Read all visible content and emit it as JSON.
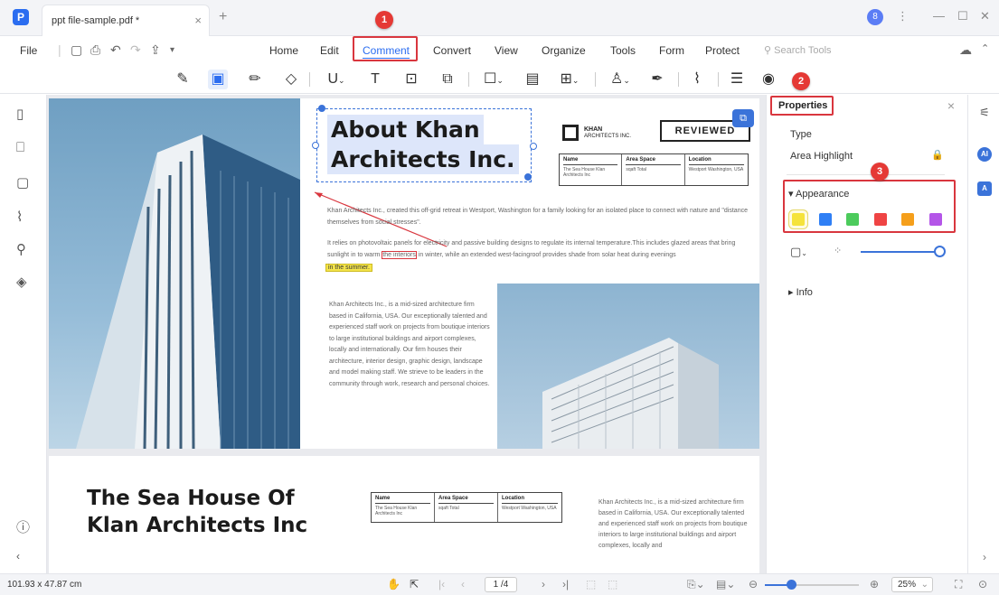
{
  "window": {
    "tab_title": "ppt file-sample.pdf *",
    "tab_close": "×",
    "new_tab": "+",
    "avatar_letter": "8",
    "more": "⋮",
    "minimize": "—",
    "maximize": "☐",
    "close": "✕"
  },
  "menu": {
    "file": "File",
    "items": [
      "Home",
      "Edit",
      "Comment",
      "Convert",
      "View",
      "Organize",
      "Tools",
      "Form",
      "Protect"
    ],
    "active": "Comment",
    "search_placeholder": "Search Tools"
  },
  "callouts": {
    "one": "1",
    "two": "2",
    "three": "3"
  },
  "document": {
    "page1": {
      "title_line1": "About Khan",
      "title_line2": "Architects Inc.",
      "logo_name": "KHAN",
      "logo_sub": "ARCHITECTS INC.",
      "stamp": "REVIEWED",
      "table": {
        "headers": [
          "Name",
          "Area Space",
          "Location"
        ],
        "values": [
          "The Sea House Klan Architects Inc",
          "sqaft Total",
          "Westport Washington, USA"
        ]
      },
      "para1": "Khan Architects Inc., created this off-grid retreat in Westport, Washington for a family looking for an isolated place to connect with nature and \"distance themselves from social stresses\".",
      "para2_a": "It relies on photovoltaic panels for electricity and passive building designs to regulate its internal temperature.This includes glazed areas that bring sunlight in to warm",
      "para2_box": "the interiors",
      "para2_b": "in winter, while an extended west-facingroof provides shade from solar heat during evenings",
      "para2_highlight": "in the summer.",
      "para3": "Khan Architects Inc., is a mid-sized architecture firm based in California, USA. Our exceptionally talented and experienced staff work on projects from boutique interiors to large institutional buildings and airport complexes, locally and internationally. Our firm houses their architecture, interior design, graphic design, landscape and model making staff. We strieve to be leaders in the community through work, research and personal choices."
    },
    "page2": {
      "title_line1": "The Sea House Of",
      "title_line2": "Klan Architects Inc",
      "table": {
        "headers": [
          "Name",
          "Area Space",
          "Location"
        ],
        "values": [
          "The Sea House Klan Architects Inc",
          "sqaft Total",
          "Westport Washington, USA"
        ]
      },
      "para": "Khan Architects Inc., is a mid-sized architecture firm based in California, USA. Our exceptionally talented and experienced staff work on projects from boutique interiors to large institutional buildings and airport complexes, locally and"
    }
  },
  "properties": {
    "title": "Properties",
    "close": "×",
    "type_label": "Type",
    "type_value": "Area Highlight",
    "appearance": "Appearance",
    "info": "Info",
    "swatches": [
      "#f5e33b",
      "#2f7ff5",
      "#4ccb5c",
      "#ef4444",
      "#f59f1b",
      "#b455e8"
    ]
  },
  "status": {
    "dimensions": "101.93 x 47.87 cm",
    "page": "1 /4",
    "zoom": "25%"
  },
  "colors": {
    "accent": "#2b6df0",
    "callout": "#e53935"
  }
}
